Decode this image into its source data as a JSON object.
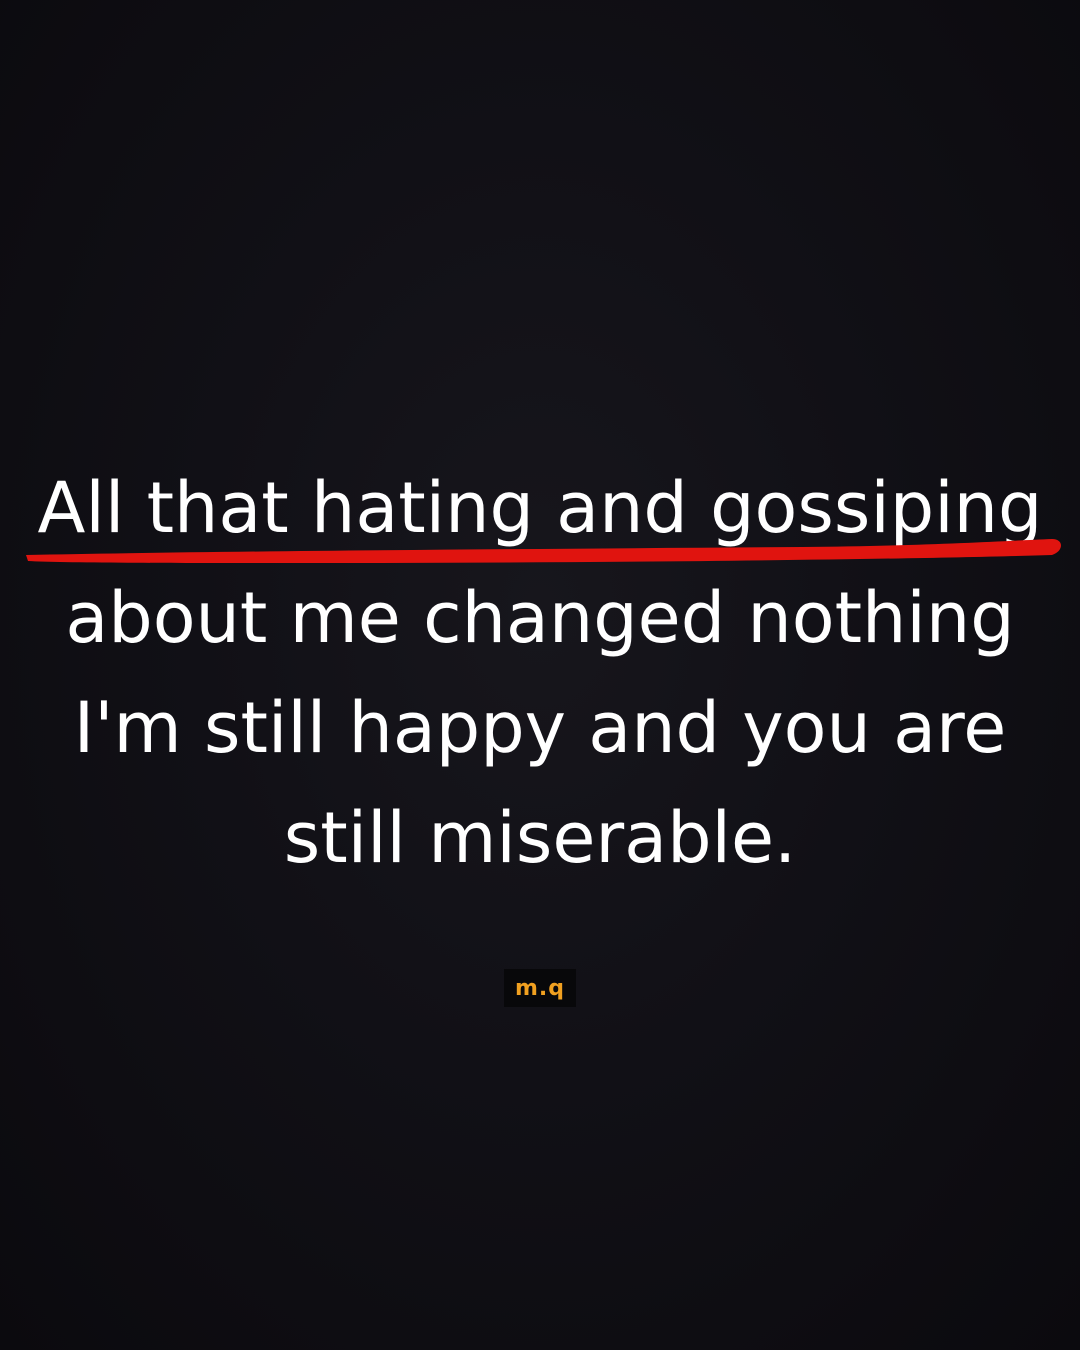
{
  "quote": {
    "lines": [
      "All that hating and gossiping",
      "about me changed nothing",
      "I'm still happy and you are",
      "still miserable."
    ]
  },
  "colors": {
    "background": "#111016",
    "text": "#ffffff",
    "underline": "#e0140f",
    "watermark": "#f0a020"
  },
  "watermark": {
    "text": "m.q"
  }
}
